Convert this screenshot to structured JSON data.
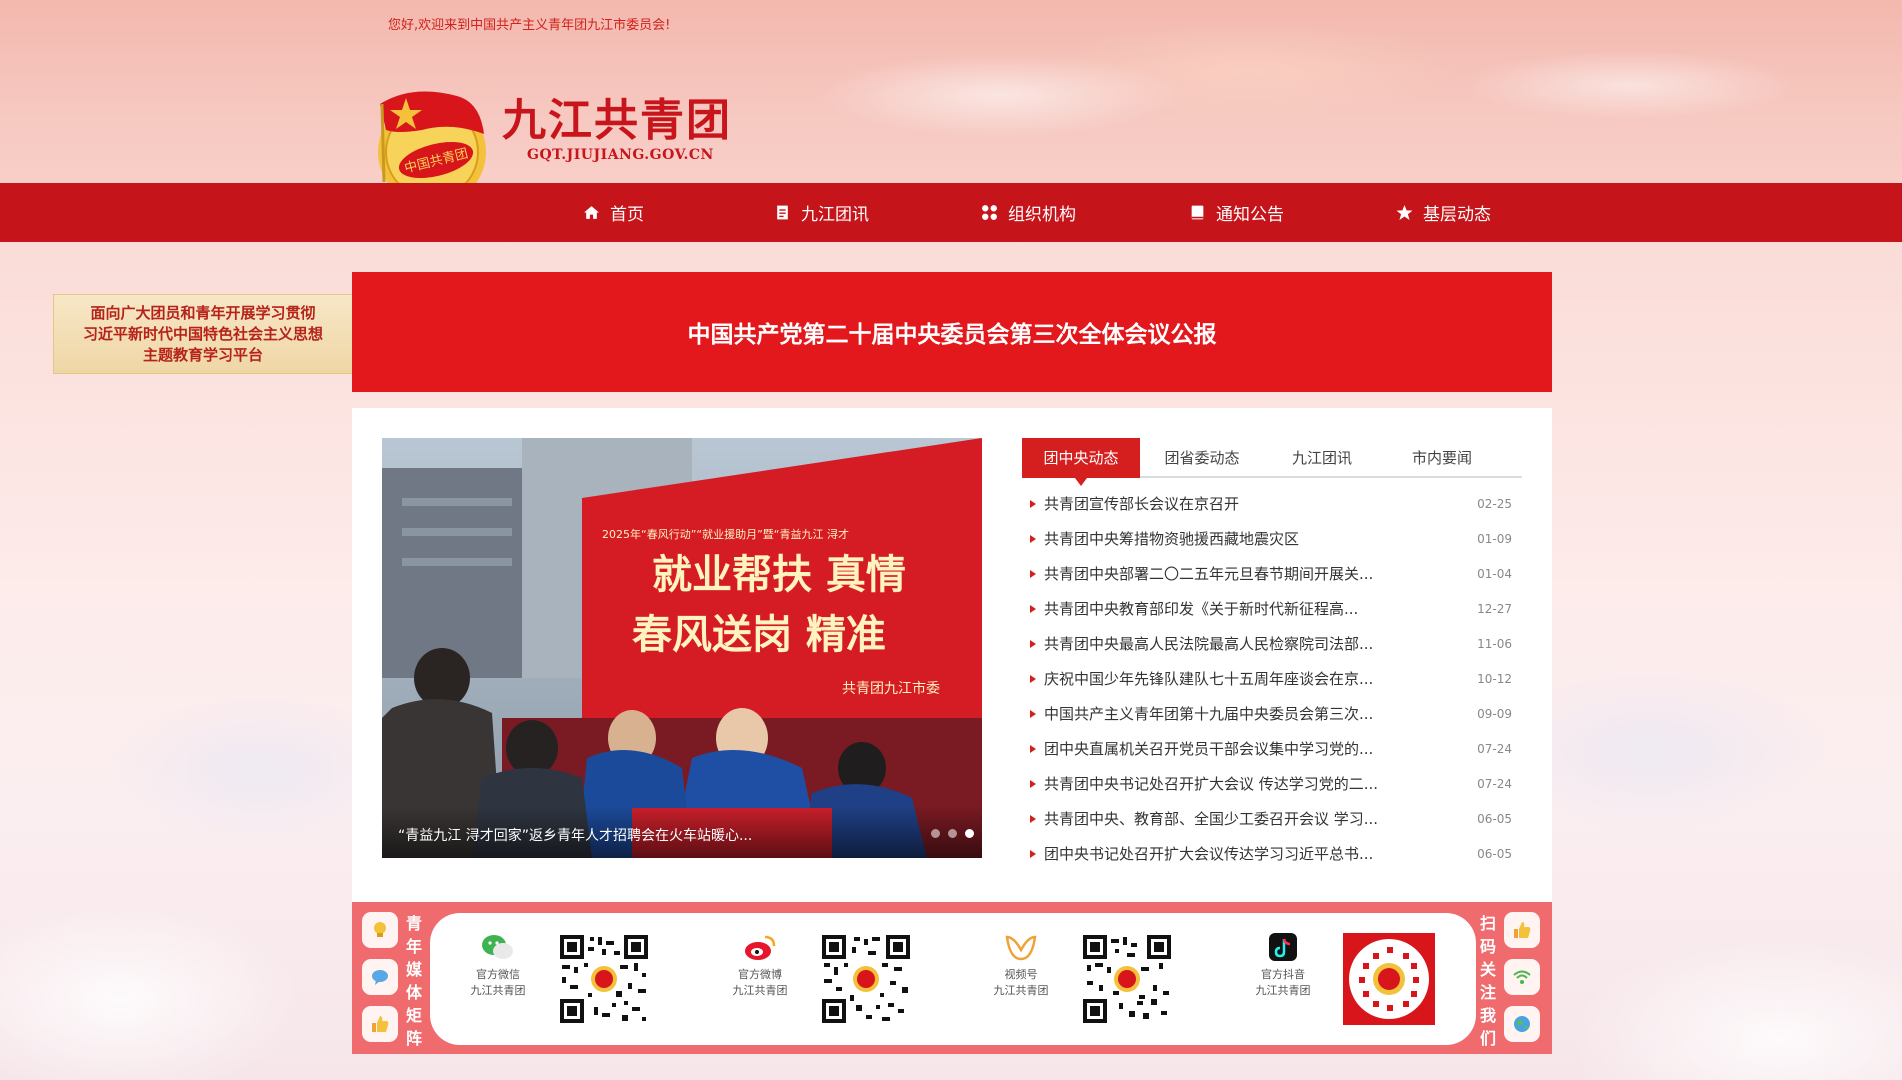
{
  "header": {
    "welcome": "您好,欢迎来到中国共产主义青年团九江市委员会!",
    "site_title": "九江共青团",
    "site_domain": "GQT.JIUJIANG.GOV.CN"
  },
  "nav": {
    "items": [
      {
        "label": "首页",
        "icon": "home-icon"
      },
      {
        "label": "九江团讯",
        "icon": "document-icon"
      },
      {
        "label": "组织机构",
        "icon": "grid-icon"
      },
      {
        "label": "通知公告",
        "icon": "book-icon"
      },
      {
        "label": "基层动态",
        "icon": "star-icon"
      }
    ]
  },
  "side_banner": {
    "lines": [
      "面向广大团员和青年开展学习贯彻",
      "习近平新时代中国特色社会主义思想",
      "主题教育学习平台"
    ]
  },
  "banner": {
    "title": "中国共产党第二十届中央委员会第三次全体会议公报"
  },
  "slideshow": {
    "caption": "“青益九江 浔才回家”返乡青年人才招聘会在火车站暖心...",
    "slide_count": 3,
    "active_index": 2,
    "photo_text": {
      "line1": "就业帮扶 真情",
      "line2": "春风送岗 精准",
      "small": "2025年“春风行动”“就业援助月”暨“青益九江 浔才",
      "org": "共青团九江市委"
    }
  },
  "tabs": [
    {
      "label": "团中央动态",
      "active": true
    },
    {
      "label": "团省委动态",
      "active": false
    },
    {
      "label": "九江团讯",
      "active": false
    },
    {
      "label": "市内要闻",
      "active": false
    }
  ],
  "news": [
    {
      "title": "共青团宣传部长会议在京召开",
      "date": "02-25"
    },
    {
      "title": "共青团中央筹措物资驰援西藏地震灾区",
      "date": "01-09"
    },
    {
      "title": "共青团中央部署二〇二五年元旦春节期间开展关...",
      "date": "01-04"
    },
    {
      "title": "共青团中央教育部印发《关于新时代新征程高...",
      "date": "12-27"
    },
    {
      "title": "共青团中央最高人民法院最高人民检察院司法部...",
      "date": "11-06"
    },
    {
      "title": "庆祝中国少年先锋队建队七十五周年座谈会在京...",
      "date": "10-12"
    },
    {
      "title": "中国共产主义青年团第十九届中央委员会第三次...",
      "date": "09-09"
    },
    {
      "title": "团中央直属机关召开党员干部会议集中学习党的...",
      "date": "07-24"
    },
    {
      "title": "共青团中央书记处召开扩大会议 传达学习党的二...",
      "date": "07-24"
    },
    {
      "title": "共青团中央、教育部、全国少工委召开会议 学习...",
      "date": "06-05"
    },
    {
      "title": "团中央书记处召开扩大会议传达学习习近平总书...",
      "date": "06-05"
    }
  ],
  "media": {
    "left_label": "青年媒体矩阵",
    "right_label": "扫码关注我们",
    "channels": [
      {
        "line1": "官方微信",
        "line2": "九江共青团",
        "icon": "wechat-icon"
      },
      {
        "line1": "官方微博",
        "line2": "九江共青团",
        "icon": "weibo-icon"
      },
      {
        "line1": "视频号",
        "line2": "九江共青团",
        "icon": "video-channel-icon"
      },
      {
        "line1": "官方抖音",
        "line2": "九江共青团",
        "icon": "douyin-icon"
      }
    ]
  },
  "colors": {
    "primary_red": "#c5141a",
    "banner_red": "#e3181c",
    "media_bar": "#ef6b6e",
    "gold": "#f3c13a"
  }
}
